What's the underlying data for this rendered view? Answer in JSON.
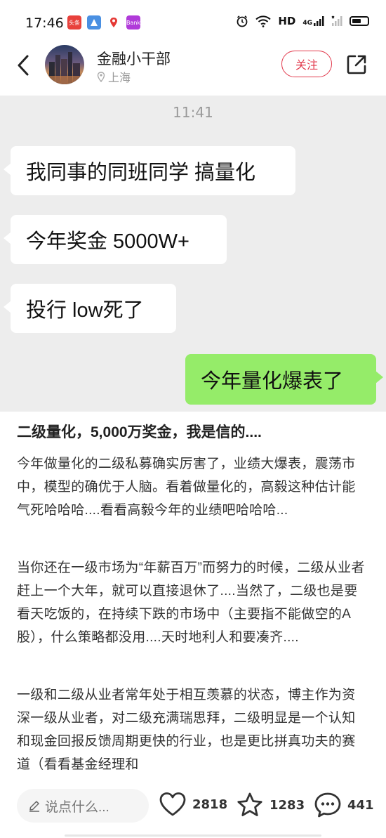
{
  "status_bar": {
    "time": "17:46",
    "app_icons": [
      {
        "name": "toutiao-app-icon",
        "label": "头条",
        "color": "#e8413c"
      },
      {
        "name": "map-app-icon",
        "label": "",
        "color": "#4a90e2"
      },
      {
        "name": "location-app-icon",
        "label": "",
        "color": "#f5f5f5"
      },
      {
        "name": "bank-app-icon",
        "label": "Bank",
        "color": "#b03ad9"
      }
    ],
    "network_label": "HD",
    "network_sub": "4G"
  },
  "header": {
    "author_name": "金融小干部",
    "location": "上海",
    "follow_label": "关注"
  },
  "chat_screenshot": {
    "time": "11:41",
    "incoming_messages": [
      "我同事的同班同学 搞量化",
      "今年奖金 5000W+",
      "投行 low死了"
    ],
    "outgoing_message": "今年量化爆表了"
  },
  "article": {
    "title": "二级量化，5,000万奖金，我是信的....",
    "paragraphs": [
      "今年做量化的二级私募确实厉害了，业绩大爆表，震荡市中，模型的确优于人脑。看着做量化的，高毅这种估计能气死哈哈哈....看看高毅今年的业绩吧哈哈哈...",
      "当你还在一级市场为“年薪百万”而努力的时候，二级从业者赶上一个大年，就可以直接退休了....当然了，二级也是要看天吃饭的，在持续下跌的市场中（主要指不能做空的A股），什么策略都没用....天时地利人和要凑齐....",
      "一级和二级从业者常年处于相互羡慕的状态，博主作为资深一级从业者，对二级充满瑞思拜，二级明显是一个认知和现金回报反馈周期更快的行业，也是更比拼真功夫的赛道（看看基金经理和"
    ]
  },
  "bottom_bar": {
    "comment_placeholder": "说点什么...",
    "likes": "2818",
    "collects": "1283",
    "comments": "441"
  },
  "colors": {
    "accent": "#e23a4d",
    "chat_bg": "#ededed",
    "outgoing_bubble": "#95ec69"
  }
}
